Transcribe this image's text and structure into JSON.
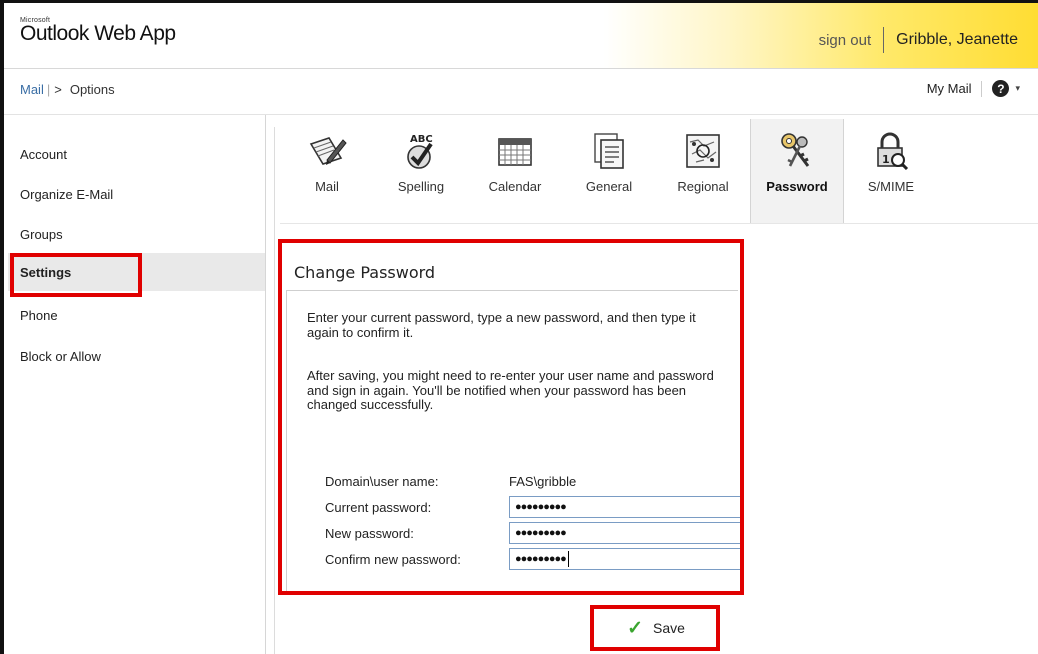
{
  "header": {
    "logo_small": "Microsoft",
    "logo_text": "Outlook Web App",
    "signout": "sign out",
    "username": "Gribble, Jeanette"
  },
  "breadcrumb": {
    "mail": "Mail",
    "separator": "|",
    "arrow": ">",
    "options": "Options"
  },
  "topright": {
    "mymail": "My Mail",
    "help_glyph": "?",
    "caret": "▾"
  },
  "sidebar": {
    "items": [
      {
        "label": "Account"
      },
      {
        "label": "Organize E-Mail"
      },
      {
        "label": "Groups"
      },
      {
        "label": "Settings"
      },
      {
        "label": "Phone"
      },
      {
        "label": "Block or Allow"
      }
    ],
    "selected": "Settings"
  },
  "tabs": [
    {
      "label": "Mail",
      "icon": "mail-settings-icon"
    },
    {
      "label": "Spelling",
      "icon": "spelling-icon"
    },
    {
      "label": "Calendar",
      "icon": "calendar-icon"
    },
    {
      "label": "General",
      "icon": "general-icon"
    },
    {
      "label": "Regional",
      "icon": "regional-icon"
    },
    {
      "label": "Password",
      "icon": "password-keys-icon"
    },
    {
      "label": "S/MIME",
      "icon": "smime-lock-icon"
    }
  ],
  "selected_tab": "Password",
  "change_password": {
    "title": "Change Password",
    "para1": "Enter your current password, type a new password, and then type it again to confirm it.",
    "para2": "After saving, you might need to re-enter your user name and password and sign in again. You'll be notified when your password has been changed successfully.",
    "domain_label": "Domain\\user name:",
    "domain_value": "FAS\\gribble",
    "current_label": "Current password:",
    "current_value": "●●●●●●●●●",
    "new_label": "New password:",
    "new_value": "●●●●●●●●●",
    "confirm_label": "Confirm new password:",
    "confirm_value": "●●●●●●●●●"
  },
  "save": {
    "icon": "✓",
    "label": "Save"
  },
  "colors": {
    "highlight": "#e00000",
    "link": "#3a6ea5",
    "check": "#3aa52f",
    "header_gradient_end": "#ffdd33"
  }
}
